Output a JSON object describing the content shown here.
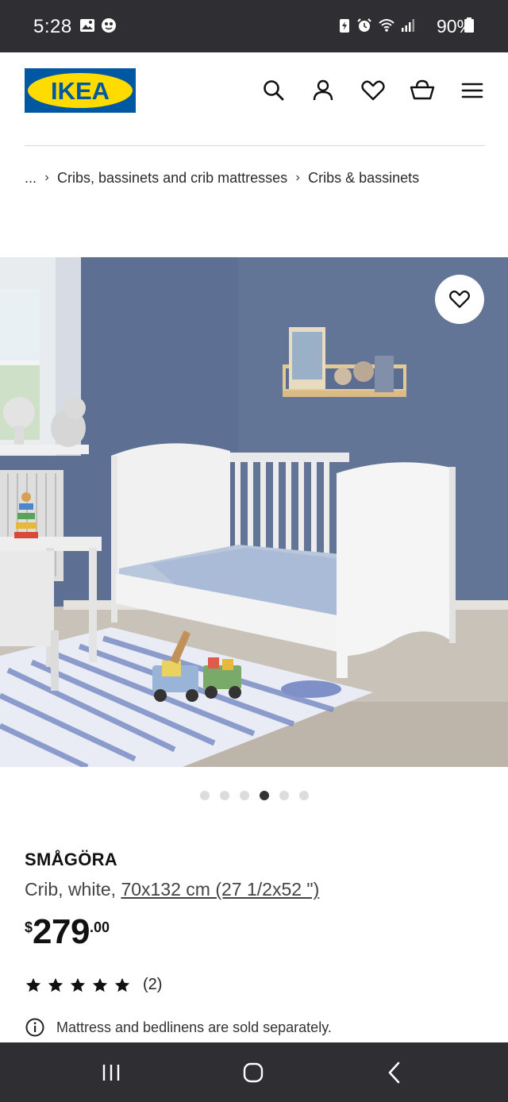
{
  "status_bar": {
    "time": "5:28",
    "battery": "90%",
    "icons": [
      "gallery-icon",
      "smart-assistant-icon",
      "battery-saver-icon",
      "alarm-icon",
      "wifi-icon",
      "signal-icon",
      "battery-icon"
    ]
  },
  "header": {
    "logo_text": "IKEA",
    "icons": [
      "search-icon",
      "account-icon",
      "favorites-icon",
      "shopping-bag-icon",
      "menu-icon"
    ],
    "colors": {
      "logo_blue": "#0058a3",
      "logo_yellow": "#ffdb00"
    }
  },
  "breadcrumb": {
    "ellipsis": "...",
    "items": [
      "Cribs, bassinets and crib mattresses",
      "Cribs & bassinets"
    ]
  },
  "gallery": {
    "image_count": 6,
    "active_index": 3,
    "favorite_icon": "heart-icon"
  },
  "product": {
    "name": "SMÅGÖRA",
    "description": "Crib, white, ",
    "size": "70x132 cm (27 1/2x52 \")",
    "price": {
      "currency": "$",
      "integer": "279",
      "decimal": ".00"
    },
    "rating": {
      "stars": 5,
      "count": "(2)"
    },
    "notice": "Mattress and bedlinens are sold separately."
  },
  "nav_bar": {
    "buttons": [
      "recent-apps-button",
      "home-button",
      "back-button"
    ]
  }
}
